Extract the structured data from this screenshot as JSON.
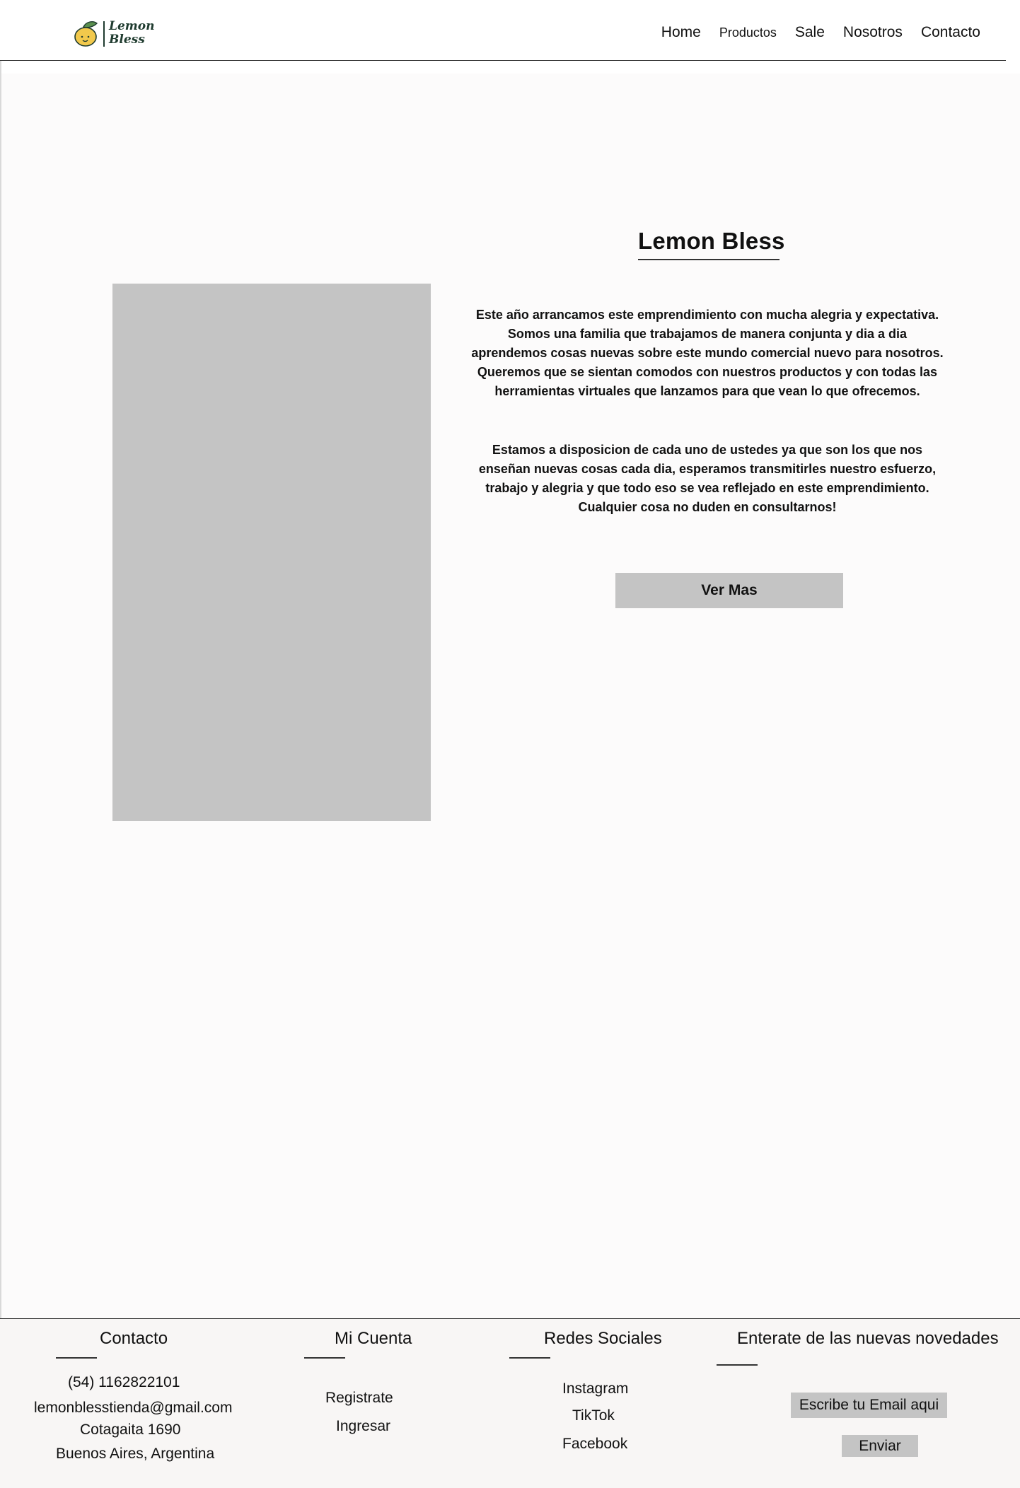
{
  "brand": {
    "line1": "Lemon",
    "line2": "Bless",
    "accent": "#f2c94c",
    "leaf": "#5a8f4e",
    "ink": "#1f3b2f"
  },
  "nav": {
    "home": "Home",
    "productos": "Productos",
    "sale": "Sale",
    "nosotros": "Nosotros",
    "contacto": "Contacto"
  },
  "about": {
    "title": "Lemon Bless",
    "p1_lines": [
      "Este año arrancamos este emprendimiento con mucha alegria y expectativa.",
      "Somos una familia que trabajamos de manera conjunta y dia a dia",
      "aprendemos cosas nuevas sobre este mundo comercial nuevo para nosotros.",
      "Queremos que se sientan comodos con nuestros productos y con todas las",
      "herramientas virtuales que lanzamos para que vean lo que ofrecemos."
    ],
    "p2_lines": [
      "Estamos a disposicion de cada uno de ustedes ya que son los que nos",
      "enseñan nuevas cosas cada dia, esperamos transmitirles nuestro esfuerzo,",
      "trabajo y alegria y que todo eso se vea reflejado en este emprendimiento.",
      "Cualquier cosa no duden en consultarnos!"
    ],
    "button": "Ver Mas",
    "image_color": "#c4c4c4"
  },
  "footer": {
    "contacto": {
      "heading": "Contacto",
      "phone": "(54) 1162822101",
      "email": "lemonblesstienda@gmail.com",
      "address": "Cotagaita 1690",
      "city": "Buenos Aires, Argentina"
    },
    "cuenta": {
      "heading": "Mi Cuenta",
      "registrate": "Registrate",
      "ingresar": "Ingresar"
    },
    "redes": {
      "heading": "Redes Sociales",
      "instagram": "Instagram",
      "tiktok": "TikTok",
      "facebook": "Facebook"
    },
    "novedades": {
      "heading": "Enterate de las nuevas novedades",
      "placeholder": "Escribe tu Email aqui",
      "submit": "Enviar"
    }
  }
}
